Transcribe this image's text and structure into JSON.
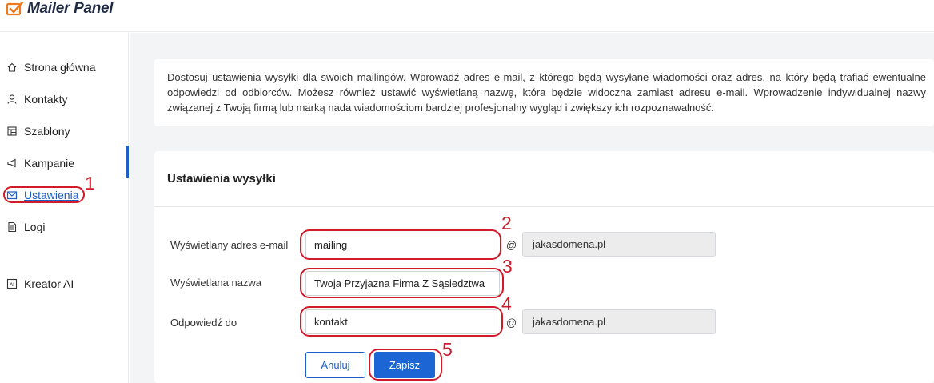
{
  "app": {
    "name": "Mailer Panel"
  },
  "sidebar": {
    "items": [
      {
        "label": "Strona główna",
        "icon": "home-icon"
      },
      {
        "label": "Kontakty",
        "icon": "user-icon"
      },
      {
        "label": "Szablony",
        "icon": "template-icon"
      },
      {
        "label": "Kampanie",
        "icon": "megaphone-icon"
      },
      {
        "label": "Ustawienia",
        "icon": "mail-icon",
        "active": true
      },
      {
        "label": "Logi",
        "icon": "document-icon"
      },
      {
        "label": "Kreator AI",
        "icon": "ai-icon"
      }
    ]
  },
  "info": {
    "text": "Dostosuj ustawienia wysyłki dla swoich mailingów. Wprowadź adres e-mail, z którego będą wysyłane wiadomości oraz adres, na który będą trafiać ewentualne odpowiedzi od odbiorców. Możesz również ustawić wyświetlaną nazwę, która będzie widoczna zamiast adresu e-mail. Wprowadzenie indywidualnej nazwy związanej z Twoją firmą lub marką nada wiadomościom bardziej profesjonalny wygląd i zwiększy ich rozpoznawalność."
  },
  "settings": {
    "title": "Ustawienia wysyłki",
    "email": {
      "label": "Wyświetlany adres e-mail",
      "value": "mailing",
      "at": "@",
      "domain": "jakasdomena.pl"
    },
    "display_name": {
      "label": "Wyświetlana nazwa",
      "value": "Twoja Przyjazna Firma Z Sąsiedztwa"
    },
    "reply_to": {
      "label": "Odpowiedź do",
      "value": "kontakt",
      "at": "@",
      "domain": "jakasdomena.pl"
    },
    "cancel_label": "Anuluj",
    "save_label": "Zapisz"
  },
  "annotations": [
    "1",
    "2",
    "3",
    "4",
    "5"
  ],
  "colors": {
    "accent": "#1b66d4",
    "annotation": "#d11a2a",
    "logo_orange": "#f07a1a"
  }
}
